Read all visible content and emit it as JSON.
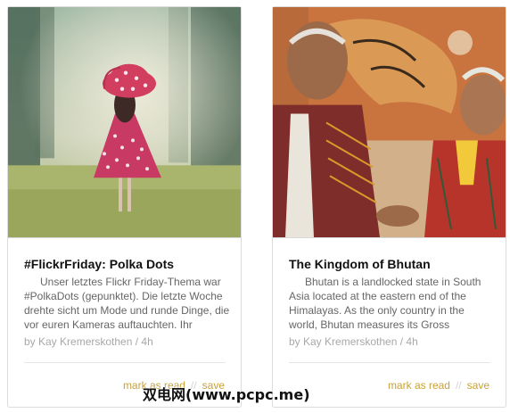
{
  "cards": [
    {
      "title": "#FlickrFriday: Polka Dots",
      "excerpt": "Unser letztes Flickr Friday-Thema war #PolkaDots (gepunktet). Die letzte Woche drehte sicht um Mode und runde Dinge, die vor euren Kameras auftauchten. Ihr",
      "meta": "by Kay Kremerskothen / 4h",
      "mark_label": "mark as read",
      "save_label": "save",
      "separator": "//"
    },
    {
      "title": "The Kingdom of Bhutan",
      "excerpt": "Bhutan is a landlocked state in South Asia located at the eastern end of the Himalayas. As the only country in the world, Bhutan measures its Gross",
      "meta": "by Kay Kremerskothen / 4h",
      "mark_label": "mark as read",
      "save_label": "save",
      "separator": "//"
    }
  ],
  "watermark": "双电网(www.pcpc.me)",
  "colors": {
    "action_link": "#c9a23a",
    "meta_text": "#a8a8a8",
    "card_border": "#dcdcdc"
  }
}
